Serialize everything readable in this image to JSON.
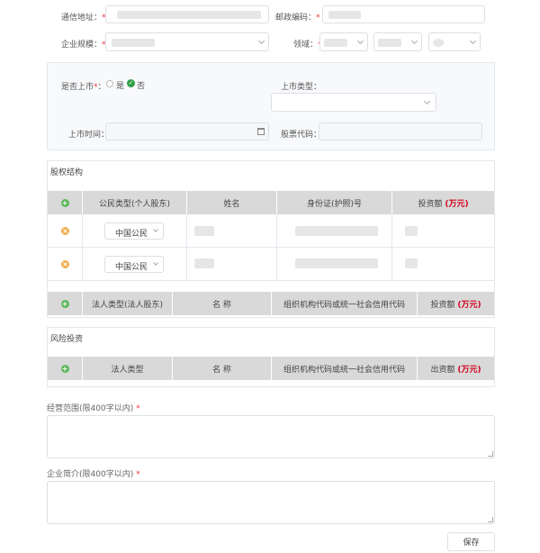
{
  "form": {
    "address_label": "通信地址",
    "postcode_label": "邮政编码",
    "scale_label": "企业规模",
    "domain_label": "领域",
    "required_mark": "*"
  },
  "listing": {
    "listed_label": "是否上市",
    "yes_label": "是",
    "no_label": "否",
    "listed_value": "否",
    "listing_type_label": "上市类型",
    "listing_time_label": "上市时间",
    "stock_code_label": "股票代码"
  },
  "equity": {
    "title": "股权结构",
    "individual_headers": [
      "公民类型(个人股东)",
      "姓名",
      "身份证(护照)号",
      "投资额"
    ],
    "amount_unit": "(万元)",
    "rows": [
      {
        "citizen_type": "中国公民"
      },
      {
        "citizen_type": "中国公民"
      }
    ],
    "corporate_headers": [
      "法人类型(法人股东)",
      "名 称",
      "组织机构代码或统一社会信用代码",
      "投资额"
    ]
  },
  "venture": {
    "title": "风险投资",
    "headers": [
      "法人类型",
      "名 称",
      "组织机构代码或统一社会信用代码",
      "出资额"
    ],
    "amount_unit": "(万元)"
  },
  "business_scope": {
    "label": "经营范围(限400字以内)"
  },
  "profile": {
    "label": "企业简介(限400字以内)"
  },
  "actions": {
    "save_label": "保存"
  }
}
